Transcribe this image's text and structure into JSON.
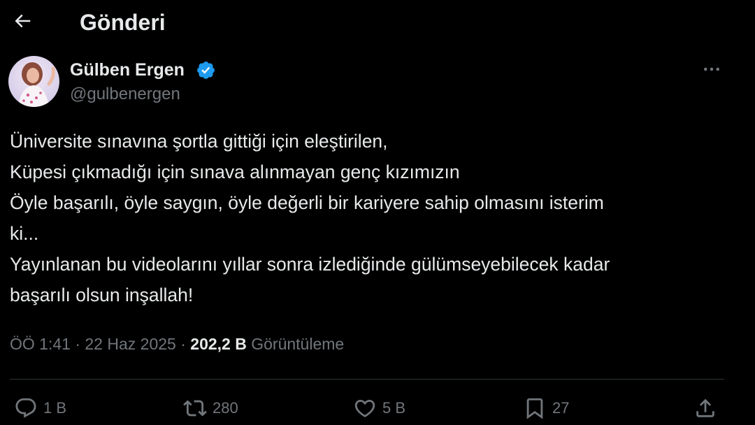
{
  "header": {
    "title": "Gönderi",
    "back_icon": "arrow-left-icon"
  },
  "author": {
    "display_name": "Gülben Ergen",
    "handle": "@gulbenergen",
    "verified_icon": "verified-badge-icon",
    "verified_color": "#1d9bf0",
    "more_icon": "more-horizontal-icon"
  },
  "tweet": {
    "lines": [
      "Üniversite sınavına şortla gittiği için eleştirilen,",
      "Küpesi çıkmadığı için sınava alınmayan genç kızımızın",
      "Öyle başarılı, öyle saygın, öyle değerli bir kariyere sahip olmasını isterim",
      "ki...",
      "Yayınlanan bu videolarını yıllar sonra izlediğinde gülümseyebilecek kadar",
      "başarılı olsun inşallah!"
    ]
  },
  "meta": {
    "time": "ÖÖ 1:41",
    "separator": "·",
    "date": "22 Haz 2025",
    "views_count": "202,2 B",
    "views_label": "Görüntüleme"
  },
  "actions": {
    "reply": {
      "icon": "reply-icon",
      "count": "1 B"
    },
    "repost": {
      "icon": "repost-icon",
      "count": "280"
    },
    "like": {
      "icon": "heart-icon",
      "count": "5 B"
    },
    "bookmark": {
      "icon": "bookmark-icon",
      "count": "27"
    },
    "share": {
      "icon": "share-icon"
    }
  },
  "colors": {
    "background": "#000000",
    "text_primary": "#e7e9ea",
    "text_secondary": "#71767b",
    "divider": "#2f3336",
    "accent": "#1d9bf0"
  }
}
